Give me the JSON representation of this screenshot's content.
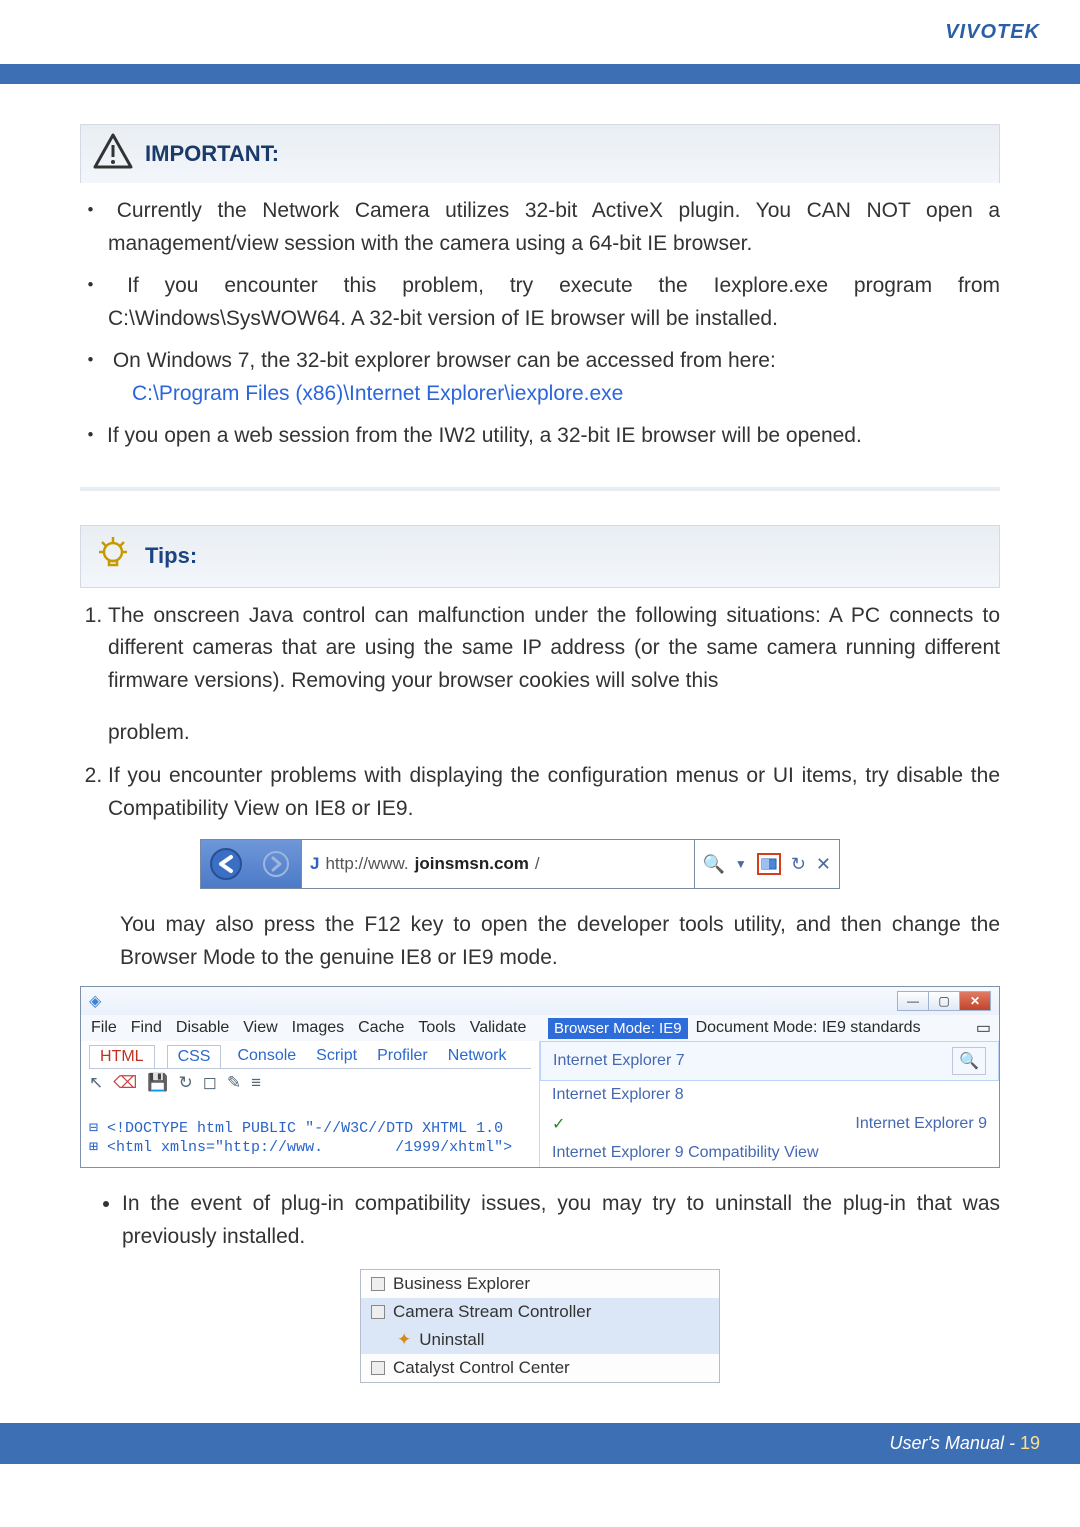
{
  "header": {
    "brand": "VIVOTEK"
  },
  "important": {
    "title": "IMPORTANT:",
    "bullets": [
      "Currently the Network Camera utilizes 32-bit ActiveX plugin. You CAN NOT open a management/view session with the camera using a 64-bit IE browser.",
      "If you encounter this problem, try execute the Iexplore.exe program from C:\\Windows\\SysWOW64. A 32-bit version of IE browser will be installed.",
      "On Windows 7, the 32-bit explorer browser can be accessed from here:",
      "If you open a web session from the IW2 utility, a 32-bit IE browser will be opened."
    ],
    "path": "C:\\Program Files (x86)\\Internet Explorer\\iexplore.exe"
  },
  "tips": {
    "title": "Tips:",
    "items": [
      "The onscreen Java control can malfunction under the following situations: A PC connects to different cameras that are using the same IP address (or the same camera running different firmware versions). Removing your browser cookies will solve this",
      "If you encounter problems with displaying the configuration menus or UI items, try disable the Compatibility View on IE8 or IE9."
    ],
    "problem_word": "problem.",
    "after_screenshot": "You may also press the F12 key to open the developer tools utility, and then change the Browser Mode to the genuine IE8 or IE9 mode.",
    "plugin_note": "In the event of plug-in compatibility issues, you may try to uninstall the plug-in that was previously installed."
  },
  "ie_bar": {
    "url_prefix": "http://www.",
    "url_domain": "joinsmsn.com",
    "url_suffix": "/"
  },
  "devtools": {
    "menus": [
      "File",
      "Find",
      "Disable",
      "View",
      "Images",
      "Cache",
      "Tools",
      "Validate"
    ],
    "browser_mode": "Browser Mode: IE9",
    "doc_mode": "Document Mode: IE9 standards",
    "tabs": [
      "HTML",
      "CSS",
      "Console",
      "Script",
      "Profiler",
      "Network"
    ],
    "code1": "⊟ <!DOCTYPE html PUBLIC \"-//W3C//DTD XHTML 1.0 ",
    "code2": "⊞ <html xmlns=\"http://www.        /1999/xhtml\">",
    "bm_items": [
      "Internet Explorer 7",
      "Internet Explorer 8",
      "Internet Explorer 9",
      "Internet Explorer 9 Compatibility View"
    ]
  },
  "uninstall": {
    "items": [
      "Business Explorer",
      "Camera Stream Controller",
      "Uninstall",
      "Catalyst Control Center"
    ]
  },
  "footer": {
    "label": "User's Manual - ",
    "page": "19"
  }
}
